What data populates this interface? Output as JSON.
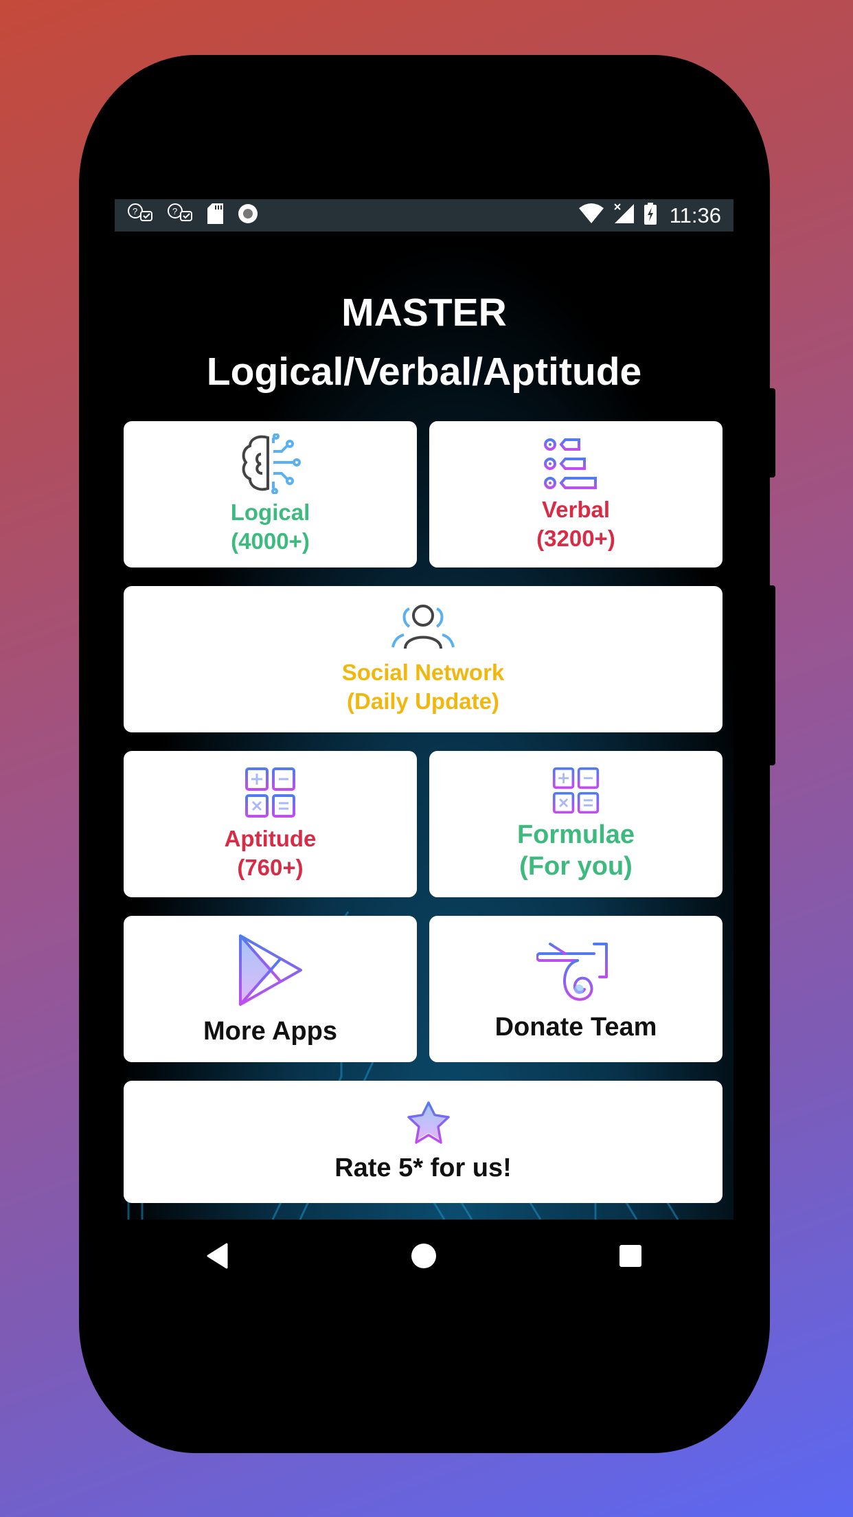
{
  "status_bar": {
    "left_icons": [
      "chat-help-icon",
      "chat-help-icon",
      "sd-card-icon",
      "record-icon"
    ],
    "right_icons": [
      "wifi-icon",
      "cell-signal-off-icon",
      "battery-charging-icon"
    ],
    "time": "11:36"
  },
  "header": {
    "title_line1": "MASTER",
    "title_line2": "Logical/Verbal/Aptitude"
  },
  "tiles": [
    {
      "id": "logical",
      "icon": "brain-circuit-icon",
      "label_line1": "Logical",
      "label_line2": "(4000+)",
      "color": "#3dba7e"
    },
    {
      "id": "verbal",
      "icon": "list-tags-icon",
      "label_line1": "Verbal",
      "label_line2": "(3200+)",
      "color": "#d92b45"
    },
    {
      "id": "social",
      "icon": "users-icon",
      "label_line1": "Social Network",
      "label_line2": "(Daily Update)",
      "color": "#f2b70f"
    },
    {
      "id": "aptitude",
      "icon": "calculator-icon",
      "label_line1": "Aptitude",
      "label_line2": "(760+)",
      "color": "#d92b45"
    },
    {
      "id": "formulae",
      "icon": "calculator-icon",
      "label_line1": "Formulae",
      "label_line2": "(For you)",
      "color": "#3dba7e"
    },
    {
      "id": "more_apps",
      "icon": "play-store-icon",
      "label_line1": "More Apps",
      "color": "#111111"
    },
    {
      "id": "donate",
      "icon": "donate-hand-icon",
      "label_line1": "Donate Team",
      "color": "#111111"
    },
    {
      "id": "rate",
      "icon": "star-icon",
      "label_line1": "Rate 5* for us!",
      "color": "#111111"
    }
  ],
  "nav": {
    "back": "back-icon",
    "home": "home-icon",
    "recents": "recents-icon"
  },
  "colors": {
    "accent_green": "#3dba7e",
    "accent_red": "#d92b45",
    "accent_yellow": "#f2b70f",
    "icon_gradient_start": "#4f7cf0",
    "icon_gradient_end": "#c34cf0",
    "statusbar_bg": "#263238"
  }
}
